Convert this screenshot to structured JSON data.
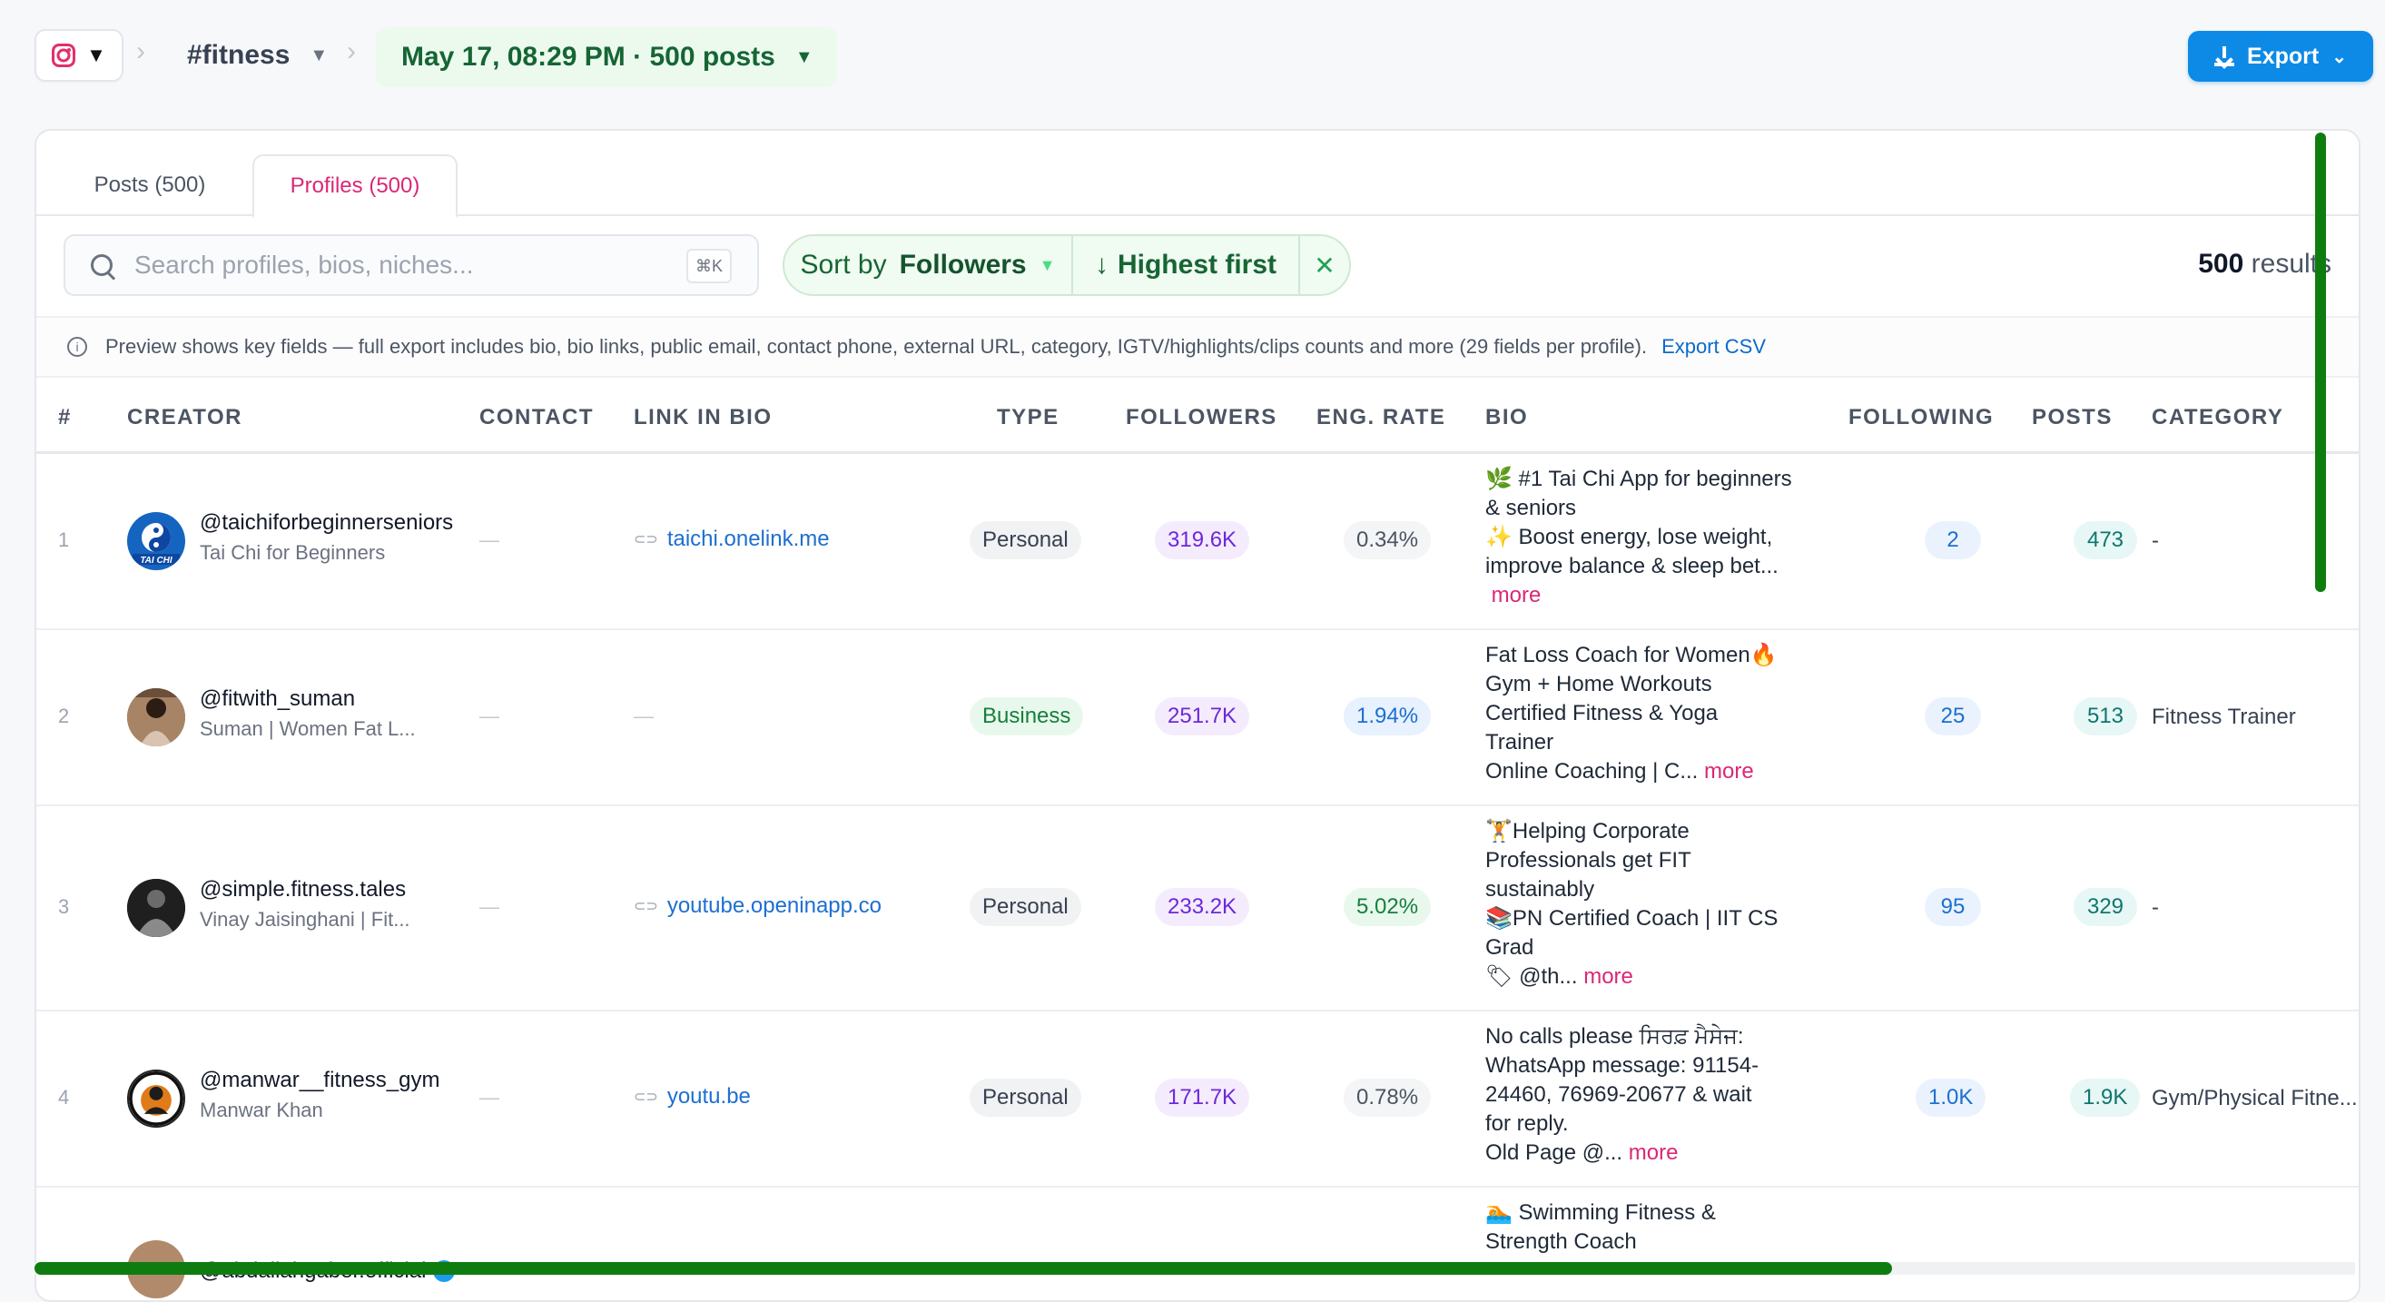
{
  "topbar": {
    "platform_icon": "instagram-icon",
    "hashtag": "#fitness",
    "run": "May 17, 08:29 PM · 500 posts",
    "export_label": "Export"
  },
  "tabs": {
    "posts": "Posts (500)",
    "profiles": "Profiles (500)"
  },
  "search": {
    "placeholder": "Search profiles, bios, niches...",
    "shortcut": "⌘K"
  },
  "sort": {
    "prefix": "Sort by",
    "field": "Followers",
    "direction": "Highest first"
  },
  "results": {
    "count": "500",
    "label": "results"
  },
  "info": {
    "text": "Preview shows key fields — full export includes bio, bio links, public email, contact phone, external URL, category, IGTV/highlights/clips counts and more (29 fields per profile).",
    "link": "Export CSV"
  },
  "columns": [
    "#",
    "CREATOR",
    "CONTACT",
    "LINK IN BIO",
    "TYPE",
    "FOLLOWERS",
    "ENG. RATE",
    "BIO",
    "FOLLOWING",
    "POSTS",
    "CATEGORY"
  ],
  "rows": [
    {
      "num": "1",
      "handle": "@taichiforbeginnerseniors",
      "name": "Tai Chi for Beginners",
      "contact": "—",
      "link": "taichi.onelink.me",
      "type": "Personal",
      "followers": "319.6K",
      "eng": "0.34%",
      "bio": [
        "🌿 #1 Tai Chi App for beginners",
        "& seniors",
        " ✨ Boost energy, lose weight,",
        "improve balance & sleep bet..."
      ],
      "bio_more": "more",
      "following": "2",
      "posts": "473",
      "category": "-"
    },
    {
      "num": "2",
      "handle": "@fitwith_suman",
      "name": "Suman | Women Fat L...",
      "contact": "—",
      "link": "—",
      "type": "Business",
      "followers": "251.7K",
      "eng": "1.94%",
      "bio": [
        "Fat Loss Coach for Women🔥",
        "Gym + Home Workouts",
        "Certified Fitness & Yoga",
        "Trainer",
        "Online Coaching | C..."
      ],
      "bio_more": "more",
      "following": "25",
      "posts": "513",
      "category": "Fitness Trainer"
    },
    {
      "num": "3",
      "handle": "@simple.fitness.tales",
      "name": "Vinay Jaisinghani | Fit...",
      "contact": "—",
      "link": "youtube.openinapp.co",
      "type": "Personal",
      "followers": "233.2K",
      "eng": "5.02%",
      "bio": [
        "🏋Helping Corporate",
        "Professionals get FIT",
        "sustainably",
        "📚PN Certified Coach | IIT CS",
        "Grad",
        "🏷 @th..."
      ],
      "bio_more": "more",
      "following": "95",
      "posts": "329",
      "category": "-"
    },
    {
      "num": "4",
      "handle": "@manwar__fitness_gym",
      "name": "Manwar Khan",
      "contact": "—",
      "link": "youtu.be",
      "type": "Personal",
      "followers": "171.7K",
      "eng": "0.78%",
      "bio": [
        "No calls please ਸਿਰਫ਼ ਮੈਸੇਜ:",
        "WhatsApp message: 91154-",
        "24460, 76969-20677 & wait",
        "for reply.",
        "Old Page @..."
      ],
      "bio_more": "more",
      "following": "1.0K",
      "posts": "1.9K",
      "category": "Gym/Physical Fitne..."
    },
    {
      "num": "5",
      "handle": "@abdallahgaber.official",
      "bio": [
        "🏊 Swimming Fitness &",
        "Strength Coach"
      ]
    }
  ]
}
